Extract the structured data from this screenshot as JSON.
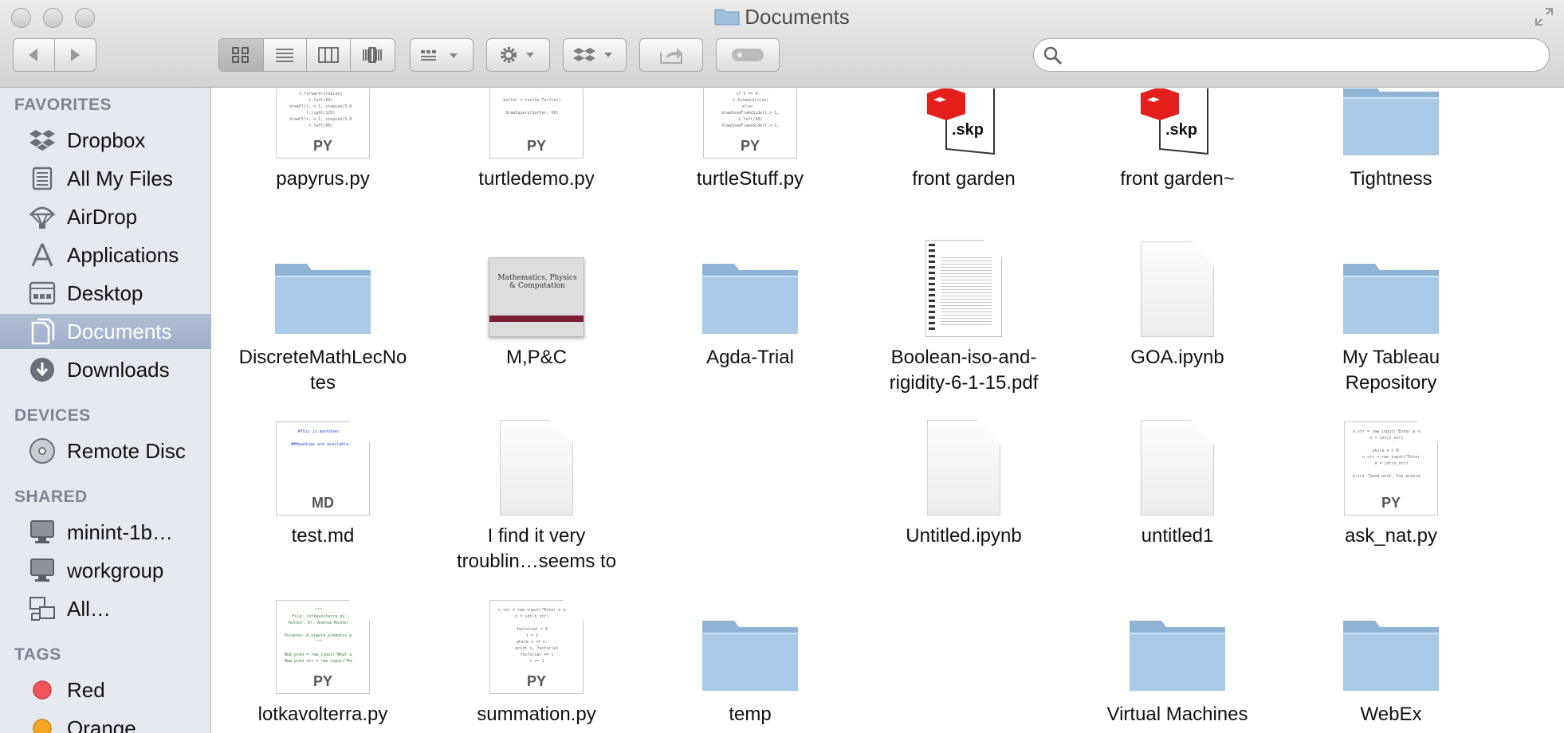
{
  "window": {
    "title": "Documents"
  },
  "toolbar": {
    "search_value": "",
    "search_placeholder": ""
  },
  "sidebar": {
    "sections": {
      "favorites": "FAVORITES",
      "devices": "DEVICES",
      "shared": "SHARED",
      "tags": "TAGS"
    },
    "favorites": [
      {
        "label": "Dropbox",
        "icon": "dropbox-icon"
      },
      {
        "label": "All My Files",
        "icon": "all-my-files-icon"
      },
      {
        "label": "AirDrop",
        "icon": "airdrop-icon"
      },
      {
        "label": "Applications",
        "icon": "applications-icon"
      },
      {
        "label": "Desktop",
        "icon": "desktop-icon"
      },
      {
        "label": "Documents",
        "icon": "documents-icon",
        "selected": true
      },
      {
        "label": "Downloads",
        "icon": "downloads-icon"
      }
    ],
    "devices": [
      {
        "label": "Remote Disc",
        "icon": "disc-icon"
      }
    ],
    "shared": [
      {
        "label": "minint-1b…",
        "icon": "monitor-icon"
      },
      {
        "label": "workgroup",
        "icon": "monitor-icon"
      },
      {
        "label": "All…",
        "icon": "network-icon"
      }
    ],
    "tags": [
      {
        "label": "Red",
        "color": "#f2555a"
      },
      {
        "label": "Orange",
        "color": "#f6a623"
      }
    ]
  },
  "files": [
    {
      "name": "papyrus.py",
      "kind": "py"
    },
    {
      "name": "turtledemo.py",
      "kind": "py"
    },
    {
      "name": "turtleStuff.py",
      "kind": "py"
    },
    {
      "name": "front garden",
      "kind": "skp",
      "ext": ".skp"
    },
    {
      "name": "front garden~",
      "kind": "skp",
      "ext": ".skp"
    },
    {
      "name": "Tightness",
      "kind": "folder"
    },
    {
      "name": "DiscreteMathLecNo",
      "name2": "tes",
      "kind": "folder"
    },
    {
      "name": "M,P&C",
      "kind": "slide",
      "slide_title": "Mathematics, Physics & Computation"
    },
    {
      "name": "Agda-Trial",
      "kind": "folder"
    },
    {
      "name": "Boolean-iso-and-",
      "name2": "rigidity-6-1-15.pdf",
      "kind": "pdf"
    },
    {
      "name": "GOA.ipynb",
      "kind": "blank"
    },
    {
      "name": "My Tableau",
      "name2": "Repository",
      "kind": "folder"
    },
    {
      "name": "test.md",
      "kind": "md",
      "ext": "MD"
    },
    {
      "name": "I find it very",
      "name2": "troublin…seems to",
      "kind": "blank"
    },
    {
      "name": "Untitled.ipynb",
      "kind": "blank"
    },
    {
      "name": "untitled1",
      "kind": "blank"
    },
    {
      "name": "ask_nat.py",
      "kind": "py"
    },
    {
      "name": "lotkavolterra.py",
      "kind": "py"
    },
    {
      "name": "summation.py",
      "kind": "py"
    },
    {
      "name": "temp",
      "kind": "folder"
    },
    {
      "name": "Virtual Machines",
      "kind": "folder"
    },
    {
      "name": "WebEx",
      "kind": "folder"
    }
  ],
  "labels": {
    "py": "PY",
    "md": "MD"
  }
}
